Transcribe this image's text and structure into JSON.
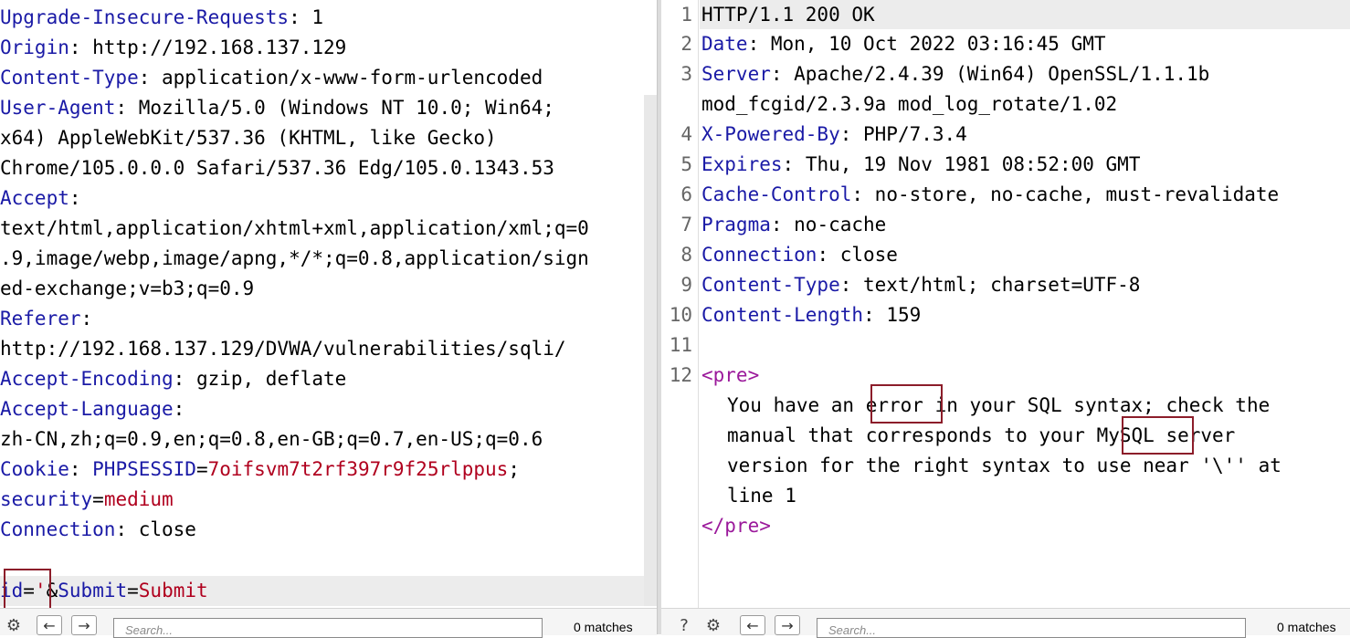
{
  "request": {
    "headers": [
      {
        "key": "Upgrade-Insecure-Requests",
        "sep": ": ",
        "value": "1"
      },
      {
        "key": "Origin",
        "sep": ": ",
        "value": "http://192.168.137.129"
      },
      {
        "key": "Content-Type",
        "sep": ": ",
        "value": "application/x-www-form-urlencoded"
      },
      {
        "key": "User-Agent",
        "sep": ": ",
        "value": "Mozilla/5.0 (Windows NT 10.0; Win64;"
      },
      {
        "continuation": "x64) AppleWebKit/537.36 (KHTML, like Gecko)"
      },
      {
        "continuation": "Chrome/105.0.0.0 Safari/537.36 Edg/105.0.1343.53"
      },
      {
        "key": "Accept",
        "sep": ":",
        "value": ""
      },
      {
        "continuation": "text/html,application/xhtml+xml,application/xml;q=0"
      },
      {
        "continuation": ".9,image/webp,image/apng,*/*;q=0.8,application/sign"
      },
      {
        "continuation": "ed-exchange;v=b3;q=0.9"
      },
      {
        "key": "Referer",
        "sep": ":",
        "value": ""
      },
      {
        "continuation": "http://192.168.137.129/DVWA/vulnerabilities/sqli/"
      },
      {
        "key": "Accept-Encoding",
        "sep": ": ",
        "value": "gzip, deflate"
      },
      {
        "key": "Accept-Language",
        "sep": ":",
        "value": ""
      },
      {
        "continuation": "zh-CN,zh;q=0.9,en;q=0.8,en-GB;q=0.7,en-US;q=0.6"
      }
    ],
    "cookie": {
      "key": "Cookie",
      "sep": ": ",
      "name1": "PHPSESSID",
      "eq": "=",
      "value1": "7oifsvm7t2rf397r9f25rlppus",
      "semi": ";",
      "name2": "security",
      "value2": "medium"
    },
    "connection": {
      "key": "Connection",
      "sep": ": ",
      "value": "close"
    },
    "body": {
      "param1": "id",
      "eq": "=",
      "value1": "'",
      "amp": "&",
      "param2": "Submit",
      "value2": "Submit"
    }
  },
  "response": {
    "line_numbers": [
      "1",
      "2",
      "3",
      "4",
      "5",
      "6",
      "7",
      "8",
      "9",
      "10",
      "11",
      "12"
    ],
    "status_line": "HTTP/1.1 200 OK",
    "headers": [
      {
        "key": "Date",
        "value": "Mon, 10 Oct 2022 03:16:45 GMT"
      },
      {
        "key": "Server",
        "value": "Apache/2.4.39 (Win64) OpenSSL/1.1.1b"
      },
      {
        "key": "X-Powered-By",
        "value": "PHP/7.3.4"
      },
      {
        "key": "Expires",
        "value": "Thu, 19 Nov 1981 08:52:00 GMT"
      },
      {
        "key": "Cache-Control",
        "value": "no-store, no-cache, must-revalidate"
      },
      {
        "key": "Pragma",
        "value": "no-cache"
      },
      {
        "key": "Connection",
        "value": "close"
      },
      {
        "key": "Content-Type",
        "value": "text/html; charset=UTF-8"
      },
      {
        "key": "Content-Length",
        "value": "159"
      }
    ],
    "server_continuation": "mod_fcgid/2.3.9a mod_log_rotate/1.02",
    "body": {
      "open_tag": "<pre>",
      "close_tag": "</pre>",
      "line1_a": "You have an ",
      "line1_hl": "error",
      "line1_b": " in your SQL syntax; check the",
      "line2_a": "manual that corresponds to your ",
      "line2_hl": "MySQL",
      "line2_b": " server",
      "line3": "version for the right syntax to use near '\\'' at",
      "line4": "line 1"
    }
  },
  "toolbar_left": {
    "search_placeholder": "Search...",
    "matches": "0 matches"
  },
  "toolbar_right": {
    "search_placeholder": "Search...",
    "matches": "0 matches"
  },
  "icons": {
    "settings": "gear-icon",
    "help": "help-icon",
    "prev": "arrow-left-icon",
    "next": "arrow-right-icon"
  },
  "colors": {
    "header_key": "#1a1aa6",
    "param_value": "#b0001e",
    "html_tag": "#9b199b",
    "highlight_border": "#8c1d2a"
  }
}
